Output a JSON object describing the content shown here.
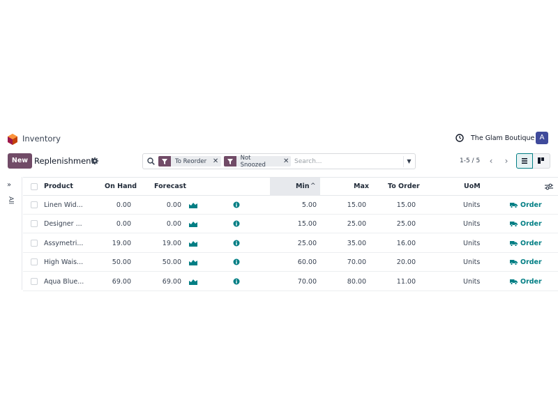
{
  "app": {
    "name": "Inventory",
    "company": "The Glam Boutique",
    "avatar_letter": "A"
  },
  "colors": {
    "brand": "#714b67",
    "accent": "#017e84",
    "avatar": "#3f4a9b"
  },
  "control_panel": {
    "new_label": "New",
    "title": "Replenishment",
    "search": {
      "facets": [
        "To Reorder",
        "Not Snoozed"
      ],
      "placeholder": "Search..."
    },
    "pager": "1-5 / 5"
  },
  "side_panel": {
    "label": "All"
  },
  "table": {
    "headers": {
      "product": "Product",
      "on_hand": "On Hand",
      "forecast": "Forecast",
      "min": "Min",
      "max": "Max",
      "to_order": "To Order",
      "uom": "UoM"
    },
    "sort_indicator": "^",
    "order_label": "Order",
    "rows": [
      {
        "product": "Linen Wid...",
        "on_hand": "0.00",
        "forecast": "0.00",
        "min": "5.00",
        "max": "15.00",
        "to_order": "15.00",
        "uom": "Units"
      },
      {
        "product": "Designer ...",
        "on_hand": "0.00",
        "forecast": "0.00",
        "min": "15.00",
        "max": "25.00",
        "to_order": "25.00",
        "uom": "Units"
      },
      {
        "product": "Assymetri...",
        "on_hand": "19.00",
        "forecast": "19.00",
        "min": "25.00",
        "max": "35.00",
        "to_order": "16.00",
        "uom": "Units"
      },
      {
        "product": "High Wais...",
        "on_hand": "50.00",
        "forecast": "50.00",
        "min": "60.00",
        "max": "70.00",
        "to_order": "20.00",
        "uom": "Units"
      },
      {
        "product": "Aqua Blue...",
        "on_hand": "69.00",
        "forecast": "69.00",
        "min": "70.00",
        "max": "80.00",
        "to_order": "11.00",
        "uom": "Units"
      }
    ]
  }
}
